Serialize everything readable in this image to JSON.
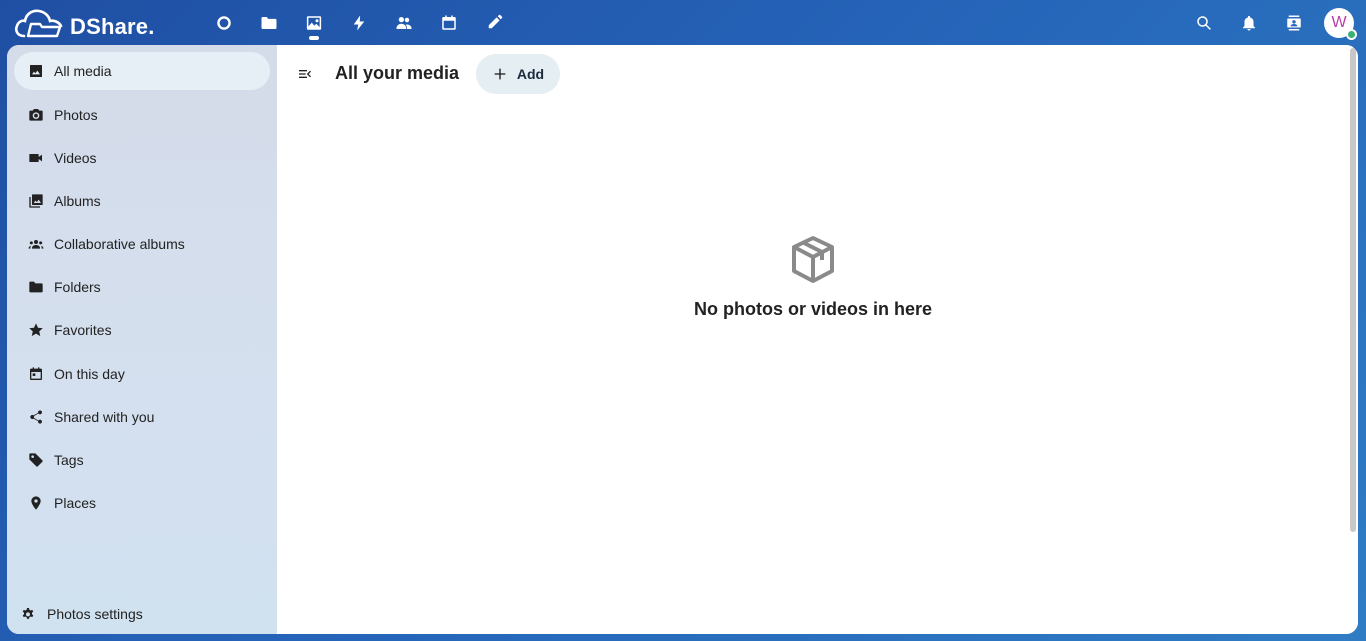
{
  "brand": {
    "name": "DShare."
  },
  "app_nav": [
    {
      "name": "dashboard",
      "icon": "circle-icon"
    },
    {
      "name": "files",
      "icon": "folder-icon"
    },
    {
      "name": "photos",
      "icon": "image-icon",
      "active": true
    },
    {
      "name": "activity",
      "icon": "lightning-icon"
    },
    {
      "name": "contacts",
      "icon": "people-icon"
    },
    {
      "name": "calendar",
      "icon": "calendar-icon"
    },
    {
      "name": "notes",
      "icon": "pencil-icon"
    }
  ],
  "header_right": {
    "search_icon": "search-icon",
    "notifications_icon": "bell-icon",
    "contacts_icon": "contacts-icon",
    "avatar_initial": "W",
    "status_color": "#3bb273"
  },
  "sidebar": {
    "items": [
      {
        "label": "All media",
        "icon": "image-icon",
        "active": true
      },
      {
        "label": "Photos",
        "icon": "camera-icon"
      },
      {
        "label": "Videos",
        "icon": "video-icon"
      },
      {
        "label": "Albums",
        "icon": "albums-icon"
      },
      {
        "label": "Collaborative albums",
        "icon": "group-icon"
      },
      {
        "label": "Folders",
        "icon": "folder-icon"
      },
      {
        "label": "Favorites",
        "icon": "star-icon"
      },
      {
        "label": "On this day",
        "icon": "calendar-icon"
      },
      {
        "label": "Shared with you",
        "icon": "share-icon"
      },
      {
        "label": "Tags",
        "icon": "tag-icon"
      },
      {
        "label": "Places",
        "icon": "map-pin-icon"
      }
    ],
    "settings_label": "Photos settings"
  },
  "main": {
    "title": "All your media",
    "add_label": "Add",
    "empty_message": "No photos or videos in here"
  },
  "colors": {
    "header_gradient_start": "#1f4fa3",
    "header_gradient_end": "#2f7cc4",
    "sidebar_bg": "#d4dbe9",
    "active_item_bg": "#e6eff5",
    "add_button_bg": "#e4eef3"
  }
}
